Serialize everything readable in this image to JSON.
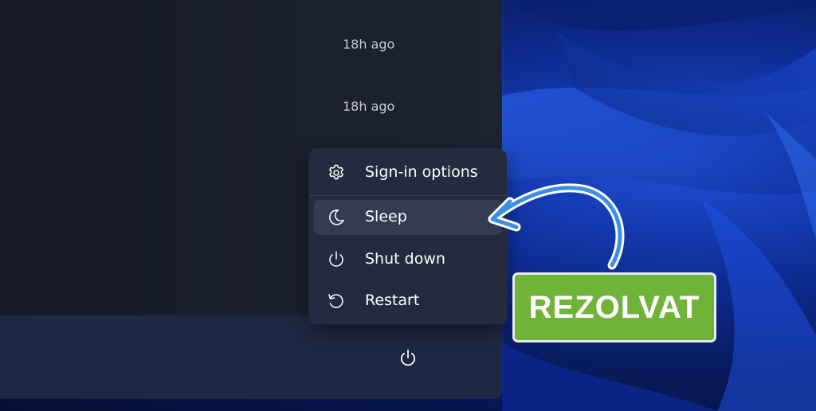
{
  "notifications": [
    {
      "time": "18h ago"
    },
    {
      "time": "18h ago"
    }
  ],
  "power_menu": {
    "items": [
      {
        "label": "Sign-in options",
        "icon": "gear-icon"
      },
      {
        "label": "Sleep",
        "icon": "moon-icon",
        "selected": true
      },
      {
        "label": "Shut down",
        "icon": "power-icon"
      },
      {
        "label": "Restart",
        "icon": "restart-icon"
      }
    ]
  },
  "footer": {
    "power_icon": "power-icon"
  },
  "annotation": {
    "badge_text": "REZOLVAT",
    "badge_color": "#6fb339",
    "arrow_color": "#3b8fe0"
  },
  "colors": {
    "menu_background": "#242b3e",
    "selected_item": "#343c52",
    "panel_background": "#1b2236"
  }
}
